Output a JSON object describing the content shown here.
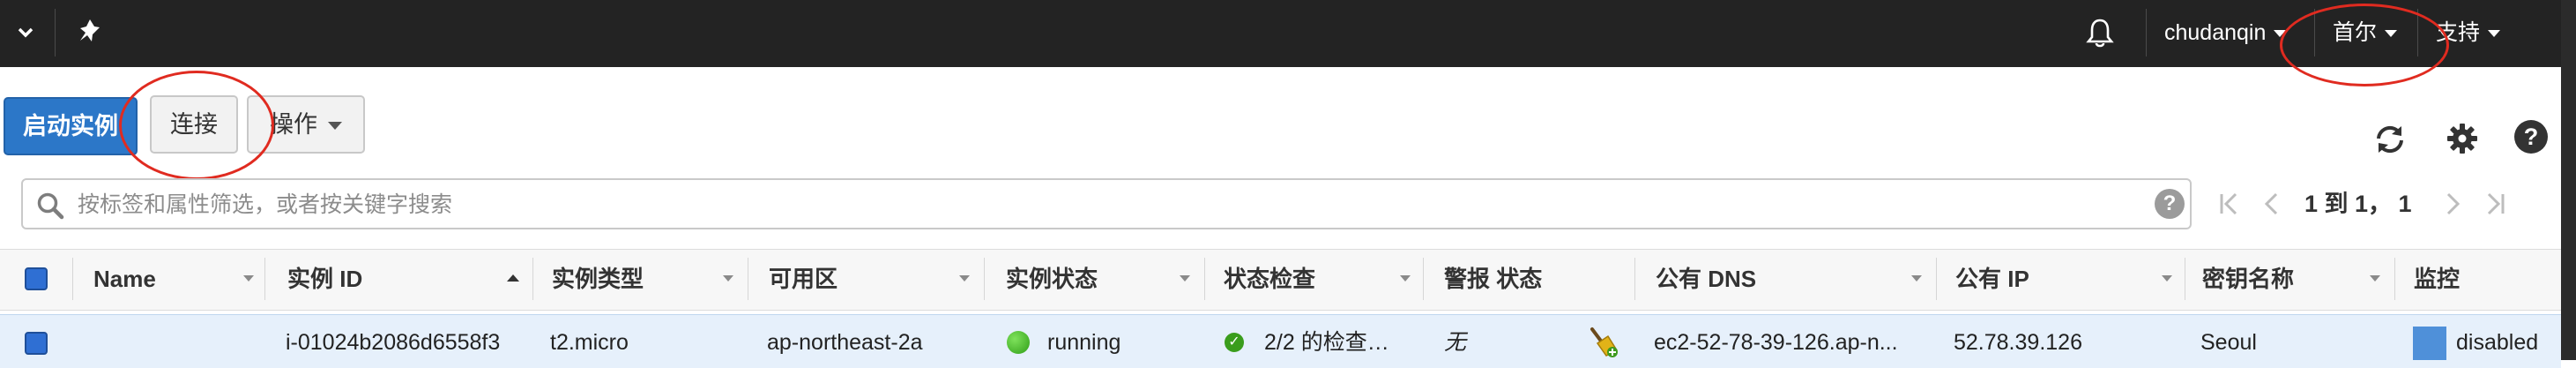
{
  "nav": {
    "user": "chudanqin",
    "region": "首尔",
    "support": "支持"
  },
  "toolbar": {
    "launch_label": "启动实例",
    "connect_label": "连接",
    "actions_label": "操作"
  },
  "search": {
    "placeholder": "按标签和属性筛选，或者按关键字搜索"
  },
  "pager": {
    "text": "1 到 1， 1"
  },
  "table": {
    "columns": [
      "Name",
      "实例 ID",
      "实例类型",
      "可用区",
      "实例状态",
      "状态检查",
      "警报 状态",
      "公有 DNS",
      "公有 IP",
      "密钥名称",
      "监控"
    ],
    "sorted_column": "实例 ID",
    "sort_direction": "ascending",
    "rows": [
      {
        "name": "",
        "instance_id": "i-01024b2086d6558f3",
        "instance_type": "t2.micro",
        "zone": "ap-northeast-2a",
        "state": "running",
        "status_check": "2/2 的检查…",
        "alarm_status": "无",
        "public_dns": "ec2-52-78-39-126.ap-n...",
        "public_ip": "52.78.39.126",
        "key_name": "Seoul",
        "monitoring": "disabled"
      }
    ]
  },
  "colors": {
    "topbar": "#232323",
    "primary_button": "#2c77c8",
    "row_selected": "#e6f0fb",
    "running_green": "#3a9d1c",
    "annotation_red": "#e02b20"
  },
  "icons": [
    "chevron-down-icon",
    "pin-icon",
    "bell-icon",
    "refresh-icon",
    "gear-icon",
    "help-icon",
    "search-icon",
    "broom-icon"
  ]
}
